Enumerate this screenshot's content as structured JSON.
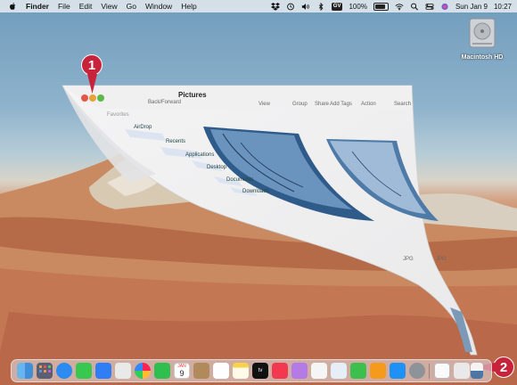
{
  "menubar": {
    "app_name": "Finder",
    "menus": [
      "File",
      "Edit",
      "View",
      "Go",
      "Window",
      "Help"
    ],
    "status": {
      "input_badge": "GV",
      "battery_pct": "100%",
      "date": "Sun Jan 9",
      "time": "10:27"
    }
  },
  "desktop": {
    "drive_label": "Macintosh HD"
  },
  "finder_window": {
    "back_forward_label": "Back/Forward",
    "title": "Pictures",
    "toolbar": {
      "view": "View",
      "group": "Group",
      "share": "Share",
      "add_tags": "Add Tags",
      "action": "Action",
      "search": "Search"
    },
    "sidebar": {
      "favorites": "Favorites",
      "items": [
        "AirDrop",
        "Recents",
        "Applications",
        "Desktop",
        "Documents",
        "Downloads"
      ]
    },
    "file_names": [
      "JPG",
      "JPG"
    ]
  },
  "callouts": {
    "step1": "1",
    "step2": "2"
  },
  "dock": {
    "calendar_month": "JAN",
    "calendar_day": "9",
    "tv_label": "tv"
  }
}
